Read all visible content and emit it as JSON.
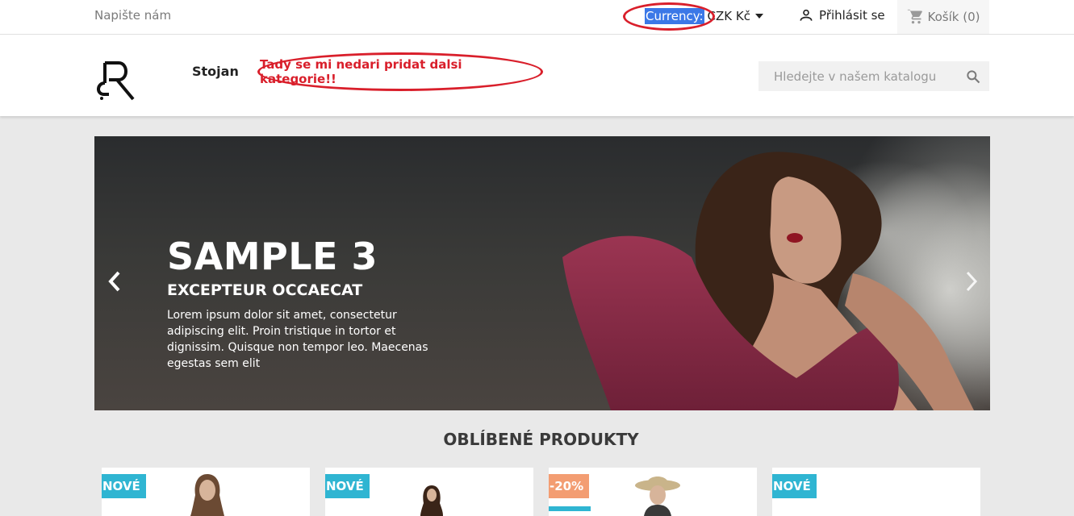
{
  "topbar": {
    "contact": "Napište nám",
    "currency_label": "Currency:",
    "currency_value": "CZK Kč",
    "login": "Přihlásit se",
    "cart": "Košík (0)"
  },
  "header": {
    "menu_item": "Stojan",
    "annotation": "Tady se mi nedari pridat dalsi kategorie!!",
    "search_placeholder": "Hledejte v našem katalogu"
  },
  "slider": {
    "title": "SAMPLE 3",
    "subtitle": "EXCEPTEUR OCCAECAT",
    "text": "Lorem ipsum dolor sit amet, consectetur adipiscing elit. Proin tristique in tortor et dignissim. Quisque non tempor leo. Maecenas egestas sem elit"
  },
  "products": {
    "title": "OBLÍBENÉ PRODUKTY",
    "items": [
      {
        "badge": "NOVÉ",
        "type": "new"
      },
      {
        "badge": "NOVÉ",
        "type": "new"
      },
      {
        "badge": "-20%",
        "type": "sale"
      },
      {
        "badge": "NOVÉ",
        "type": "new"
      }
    ]
  },
  "colors": {
    "accent": "#2fb5d2",
    "sale": "#f39d72",
    "annotation": "#d91f2b",
    "selection": "#3b78e7"
  }
}
